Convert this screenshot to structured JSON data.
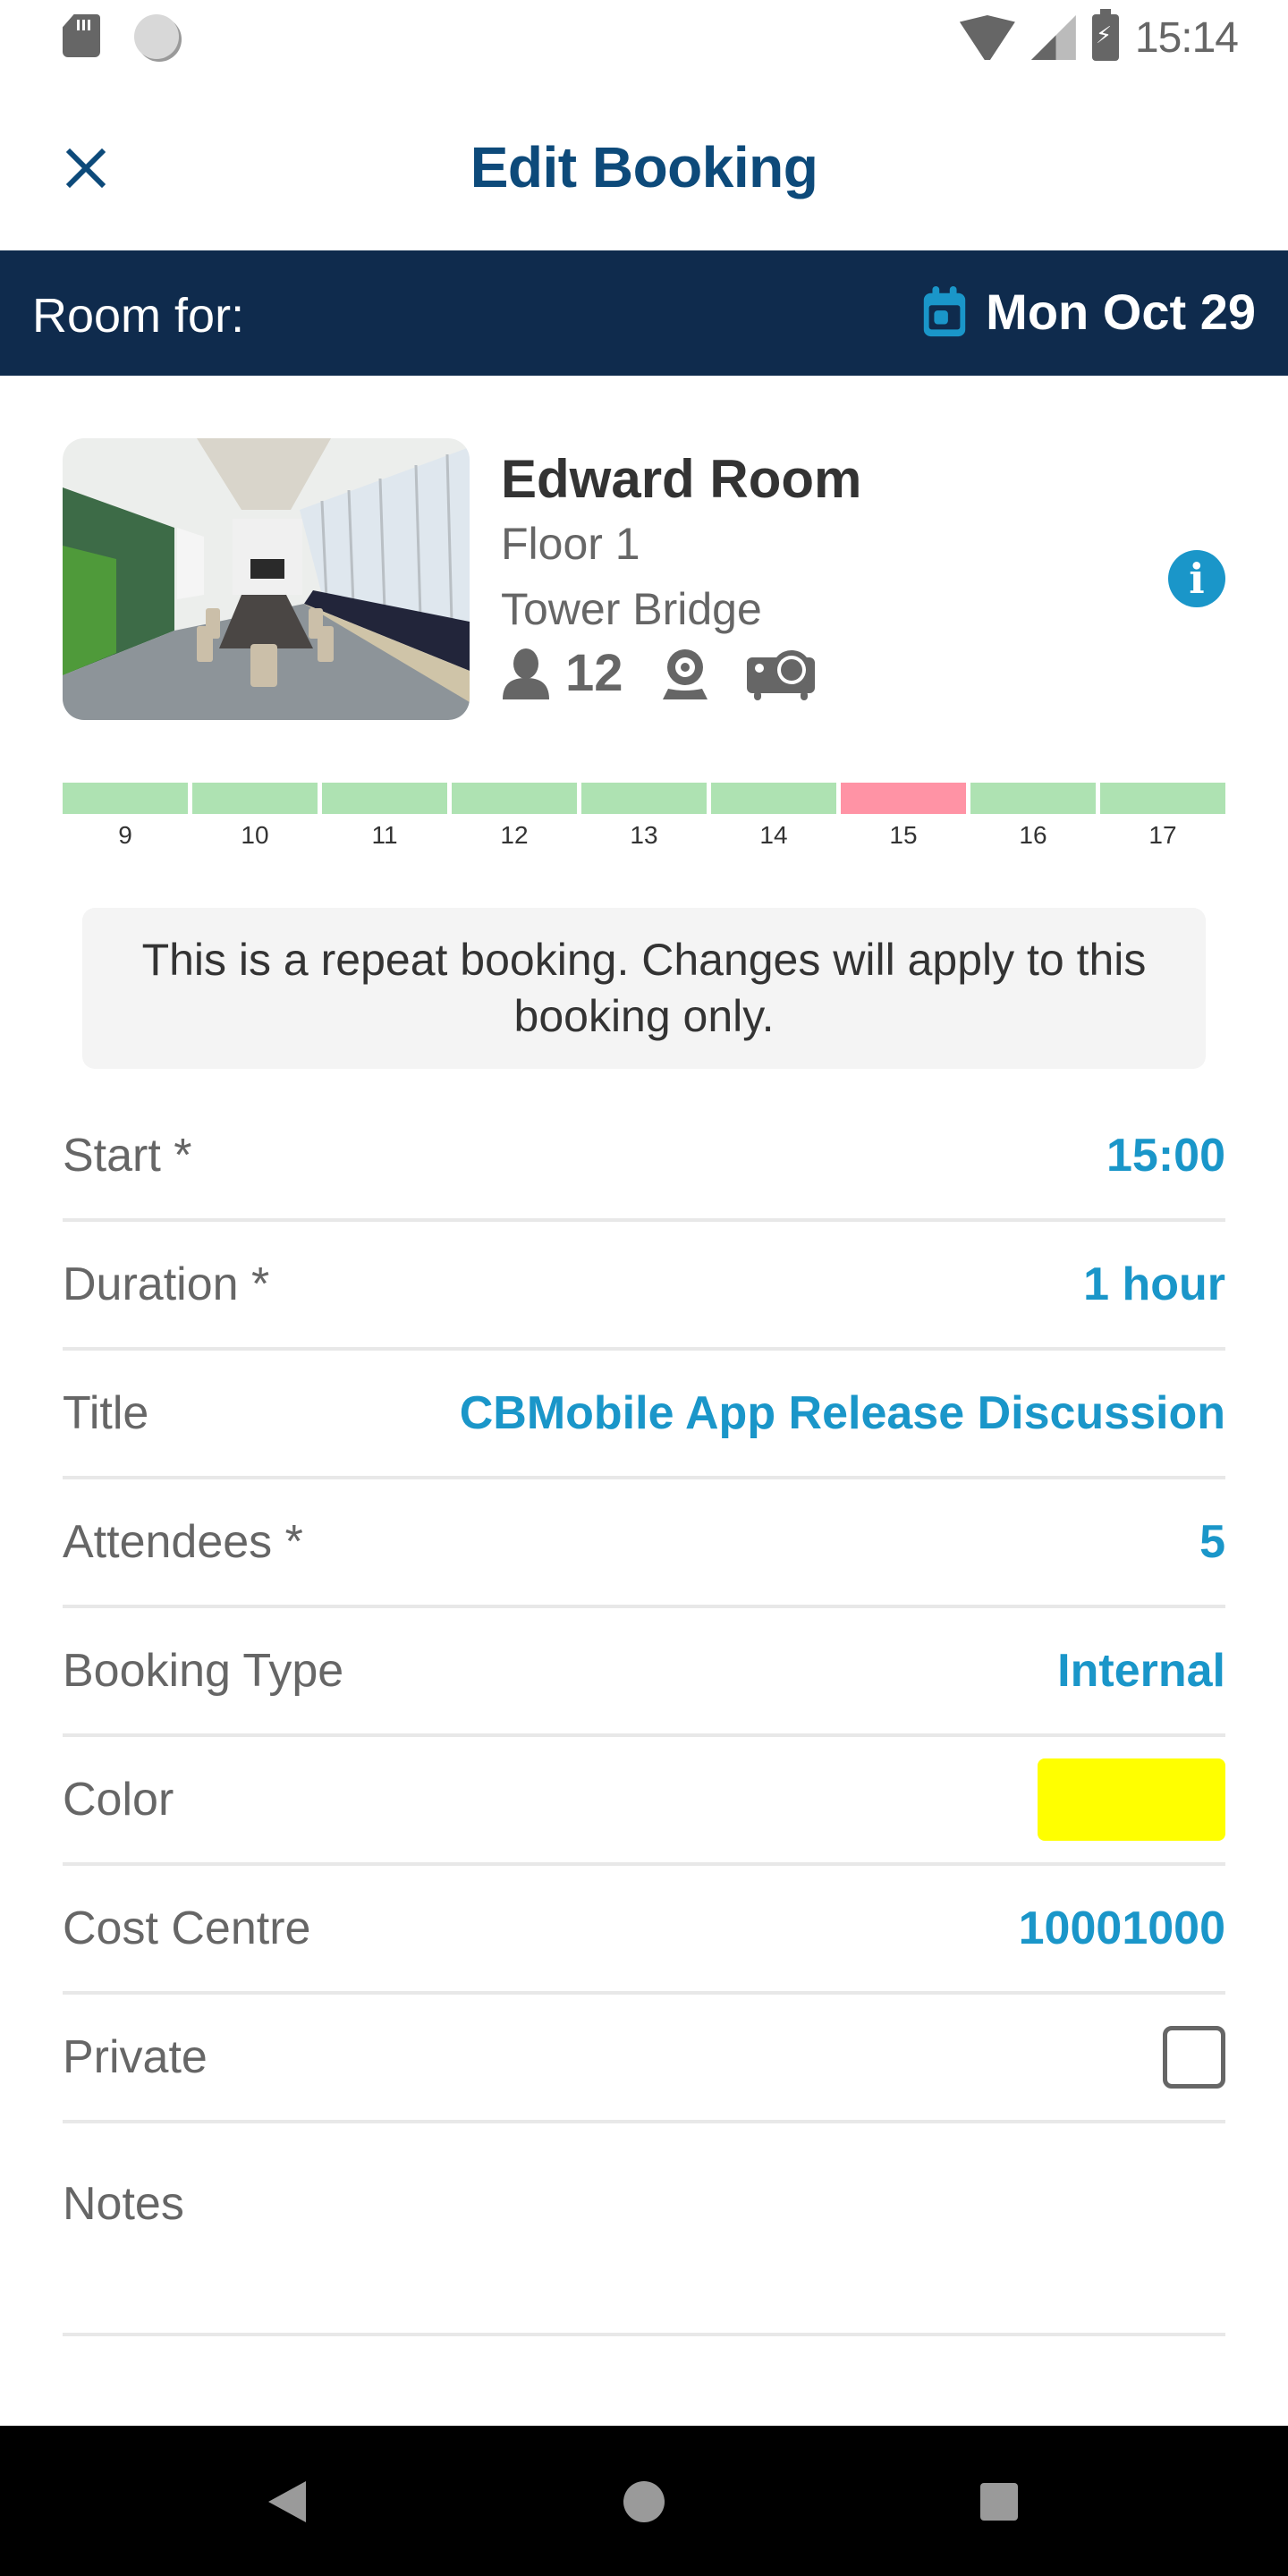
{
  "status_bar": {
    "time": "15:14",
    "left_icons": [
      "sd-card-icon",
      "sync-icon"
    ],
    "right_icons": [
      "wifi-icon",
      "cell-signal-icon",
      "battery-charging-icon"
    ]
  },
  "app_bar": {
    "title": "Edit Booking",
    "close_icon": "close-icon"
  },
  "room_for_bar": {
    "label": "Room for:",
    "date": "Mon Oct 29",
    "date_icon": "calendar-icon"
  },
  "room": {
    "name": "Edward Room",
    "floor": "Floor 1",
    "building": "Tower Bridge",
    "capacity": "12",
    "amenities": [
      "person-icon",
      "webcam-icon",
      "projector-icon"
    ],
    "info_icon": "info-icon",
    "info_glyph": "i",
    "image_alt": "Conference room photo"
  },
  "timeline": {
    "slots": [
      {
        "hour": "9",
        "status": "free"
      },
      {
        "hour": "10",
        "status": "free"
      },
      {
        "hour": "11",
        "status": "free"
      },
      {
        "hour": "12",
        "status": "free"
      },
      {
        "hour": "13",
        "status": "free"
      },
      {
        "hour": "14",
        "status": "free"
      },
      {
        "hour": "15",
        "status": "booked"
      },
      {
        "hour": "16",
        "status": "free"
      },
      {
        "hour": "17",
        "status": "free"
      }
    ],
    "colors": {
      "free": "#aee2b2",
      "booked": "#ff93a5"
    }
  },
  "notice": {
    "text": "This is a repeat booking. Changes will apply to this booking only."
  },
  "form": {
    "rows": [
      {
        "label": "Start *",
        "value": "15:00",
        "type": "value"
      },
      {
        "label": "Duration *",
        "value": "1 hour",
        "type": "value"
      },
      {
        "label": "Title",
        "value": "CBMobile App Release Discussion",
        "type": "value"
      },
      {
        "label": "Attendees *",
        "value": "5",
        "type": "value"
      },
      {
        "label": "Booking Type",
        "value": "Internal",
        "type": "value"
      },
      {
        "label": "Color",
        "value": "#ffff00",
        "type": "color"
      },
      {
        "label": "Cost Centre",
        "value": "10001000",
        "type": "value"
      },
      {
        "label": "Private",
        "checked": false,
        "type": "checkbox"
      },
      {
        "label": "Notes",
        "value": "",
        "type": "notes"
      }
    ]
  },
  "nav_bar": {
    "buttons": [
      "back-icon",
      "home-icon",
      "recents-icon"
    ]
  },
  "colors": {
    "brand_navy": "#0f2b4d",
    "title_blue": "#0d4a7a",
    "accent_blue": "#1a96c9",
    "label_gray": "#666666",
    "booking_color": "#ffff00"
  }
}
